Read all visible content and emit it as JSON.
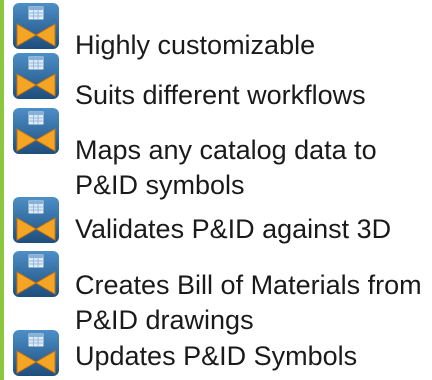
{
  "colors": {
    "accent_bar": "#8cc63f",
    "icon_top": "#4d8fc7",
    "icon_bottom": "#1f4e7c",
    "icon_window": "#d9e9f7",
    "icon_window_header": "#8ab0d6",
    "icon_bowtie": "#f5a524",
    "icon_bowtie_edge": "#c87210"
  },
  "icon_name": "pid-valve-symbol-icon",
  "features": [
    {
      "lines": [
        "Highly customizable"
      ]
    },
    {
      "lines": [
        "Suits different workflows"
      ]
    },
    {
      "lines": [
        "Maps any catalog data to",
        "P&ID symbols"
      ]
    },
    {
      "lines": [
        "Validates P&ID against 3D"
      ]
    },
    {
      "lines": [
        "Creates Bill of Materials from",
        "P&ID drawings"
      ]
    },
    {
      "lines": [
        "Updates P&ID Symbols"
      ]
    }
  ]
}
